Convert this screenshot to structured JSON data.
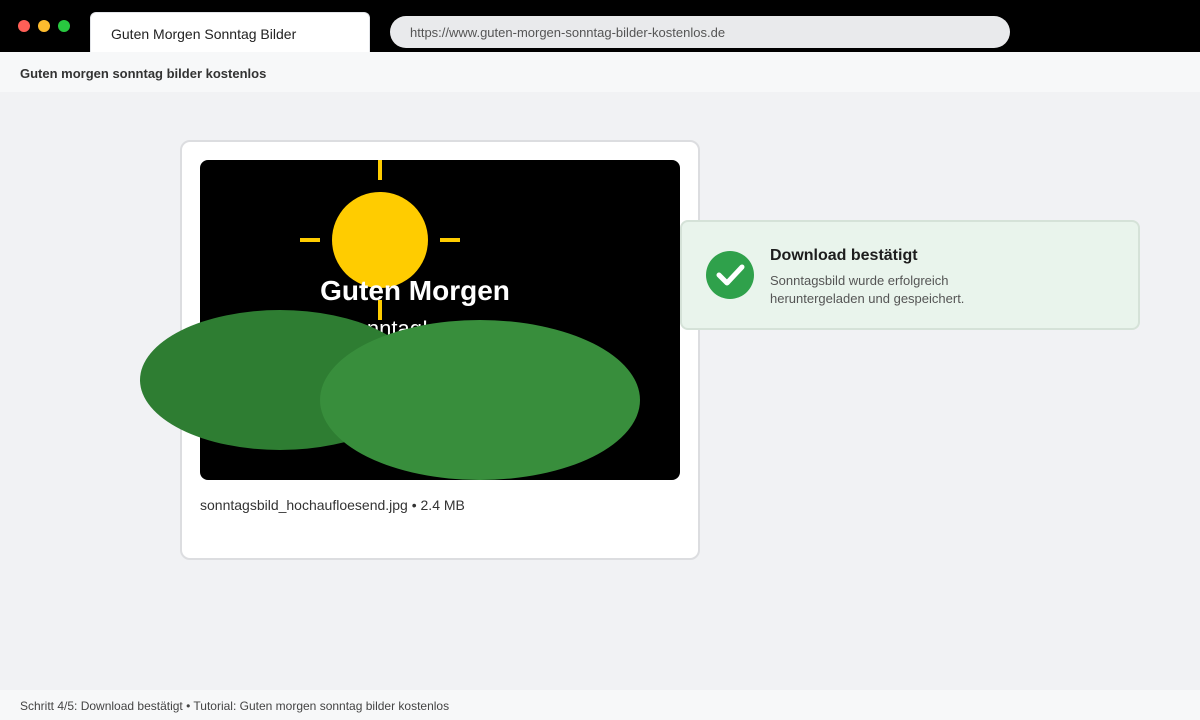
{
  "browser": {
    "tab_title": "Guten Morgen Sonntag Bilder",
    "url": "https://www.guten-morgen-sonntag-bilder-kostenlos.de"
  },
  "page": {
    "title": "Guten morgen sonntag bilder kostenlos"
  },
  "image_card": {
    "heading": "Guten Morgen",
    "subheading": "Sonntag!",
    "file_info": "sonntagsbild_hochaufloesend.jpg • 2.4 MB"
  },
  "toast": {
    "title": "Download bestätigt",
    "message": "Sonntagsbild wurde erfolgreich heruntergeladen und gespeichert.",
    "icon": "check-icon"
  },
  "status": {
    "text": "Schritt 4/5: Download bestätigt • Tutorial: Guten morgen sonntag bilder kostenlos"
  },
  "colors": {
    "sun": "#ffcc00",
    "hill_dark": "#2e7d32",
    "hill_light": "#388e3c",
    "success": "#2fa14b"
  }
}
